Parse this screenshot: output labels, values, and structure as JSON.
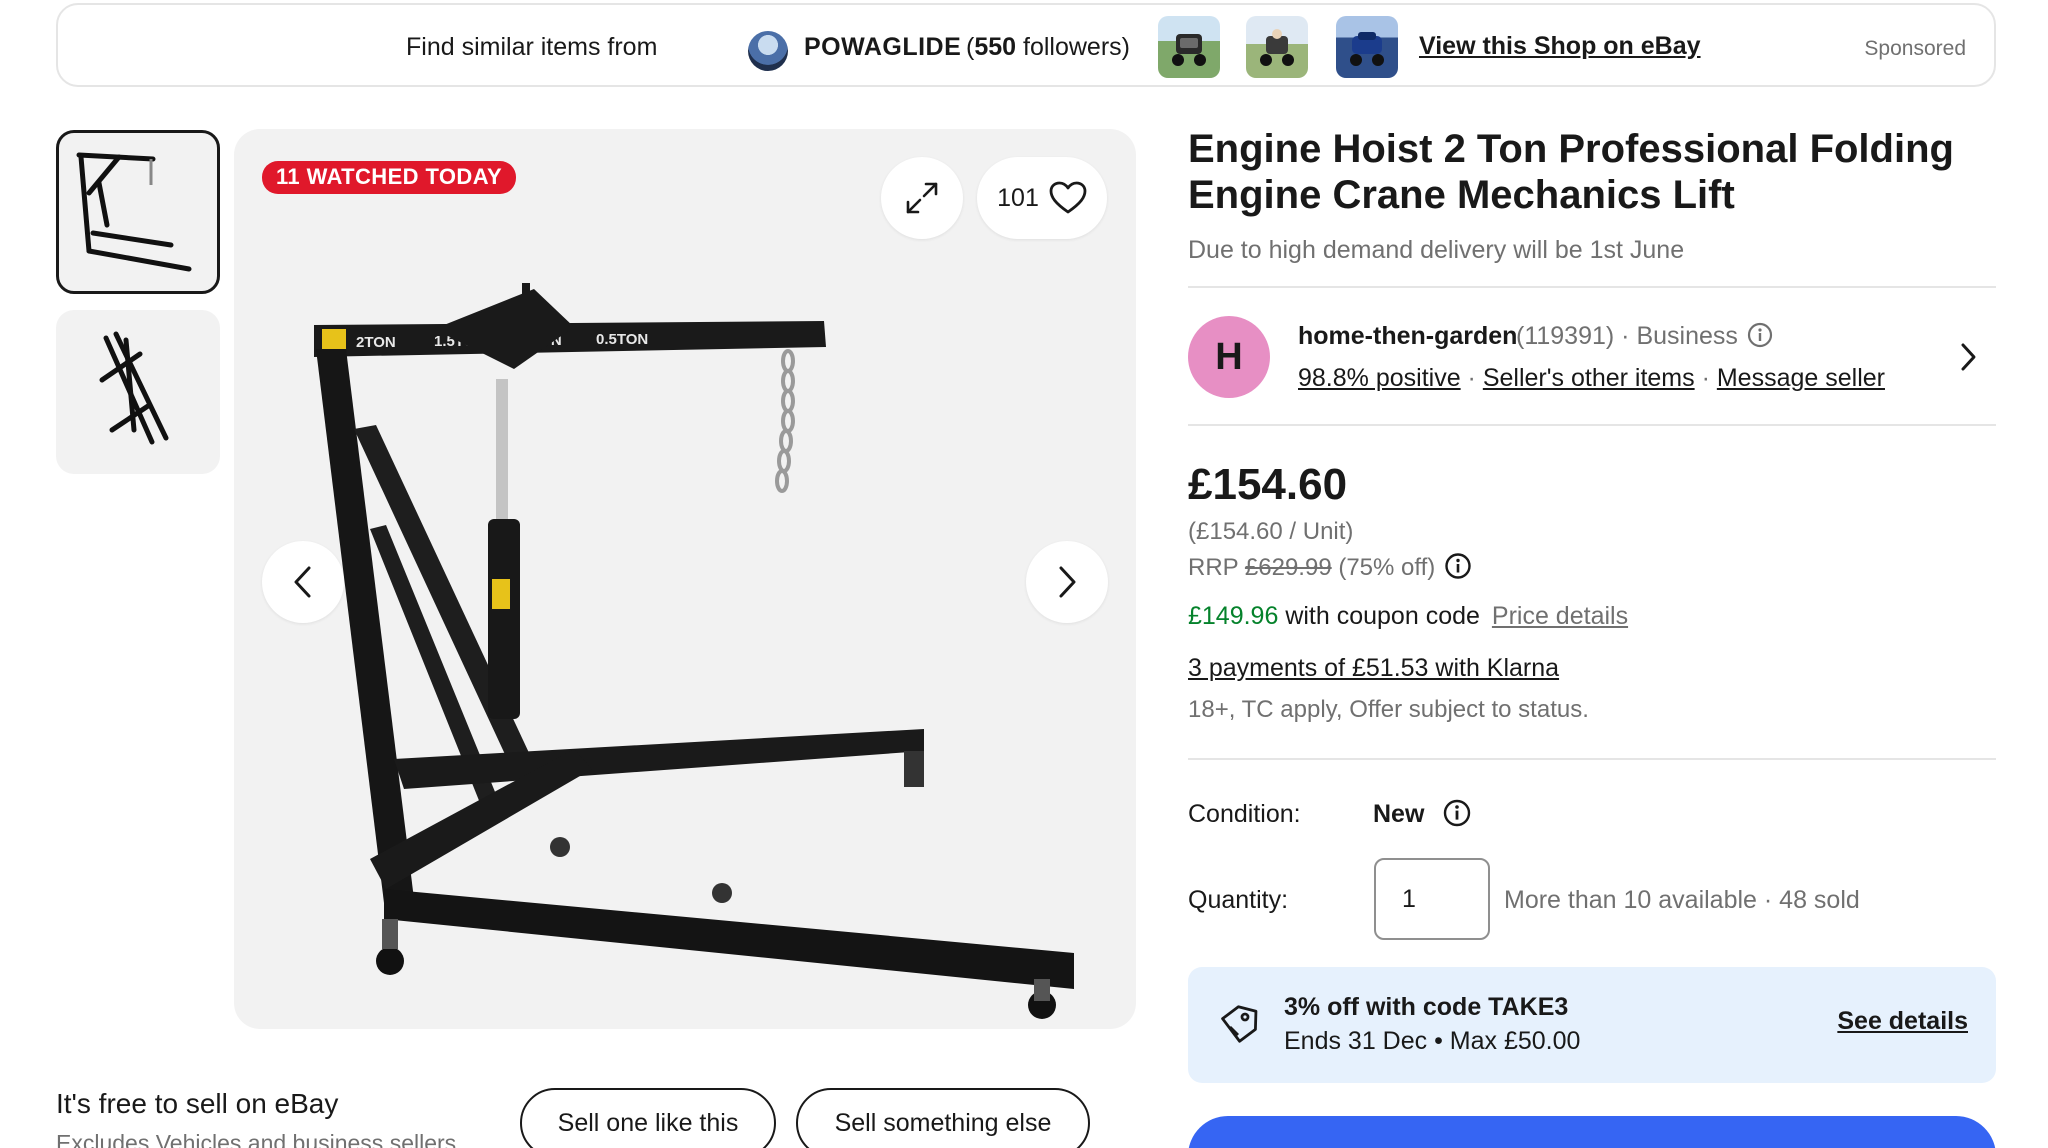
{
  "banner": {
    "find_text": "Find similar items from",
    "shop_name": "POWAGLIDE",
    "followers_open": "(",
    "followers_count": "550",
    "followers_close": " followers)",
    "view_shop": "View this Shop on eBay",
    "sponsored": "Sponsored"
  },
  "gallery": {
    "watched_badge": "11 WATCHED TODAY",
    "watch_count": "101",
    "image_labels": [
      "2TON",
      "1.5TON",
      "1TON",
      "0.5TON"
    ]
  },
  "sell": {
    "title": "It's free to sell on eBay",
    "subtitle": "Excludes Vehicles and business sellers",
    "sell_one": "Sell one like this",
    "sell_other": "Sell something else"
  },
  "listing": {
    "title": "Engine Hoist 2 Ton Professional Folding Engine Crane Mechanics Lift",
    "subtitle": "Due to high demand delivery will be 1st June"
  },
  "seller": {
    "initial": "H",
    "name": "home-then-garden",
    "feedback_count": "(119391)",
    "separator": " · ",
    "type": "Business",
    "positive": "98.8% positive",
    "other_items": "Seller's other items",
    "message": "Message seller"
  },
  "pricing": {
    "price": "£154.60",
    "unit_price": "(£154.60 / Unit)",
    "rrp_label": "RRP ",
    "rrp_value": "£629.99",
    "discount": " (75% off)",
    "coupon_price": "£149.96",
    "coupon_text": " with coupon code",
    "price_details": "Price details",
    "klarna": "3 payments of £51.53 with Klarna",
    "klarna_note": "18+, TC apply, Offer subject to status."
  },
  "condition": {
    "label": "Condition:",
    "value": "New"
  },
  "quantity": {
    "label": "Quantity:",
    "value": "1",
    "availability": "More than 10 available",
    "sold": "48 sold",
    "separator": " · "
  },
  "promo": {
    "line1": "3% off with code TAKE3",
    "line2": "Ends 31 Dec • Max £50.00",
    "see_details": "See details"
  },
  "colors": {
    "badge_red": "#e0182b",
    "price_green": "#05822b",
    "promo_bg": "#e6f1fd",
    "ebay_blue": "#3665f3",
    "avatar_pink": "#e78fc4"
  },
  "icons": [
    "expand-icon",
    "heart-icon",
    "chevron-left-icon",
    "chevron-right-icon",
    "info-icon",
    "tag-icon"
  ]
}
